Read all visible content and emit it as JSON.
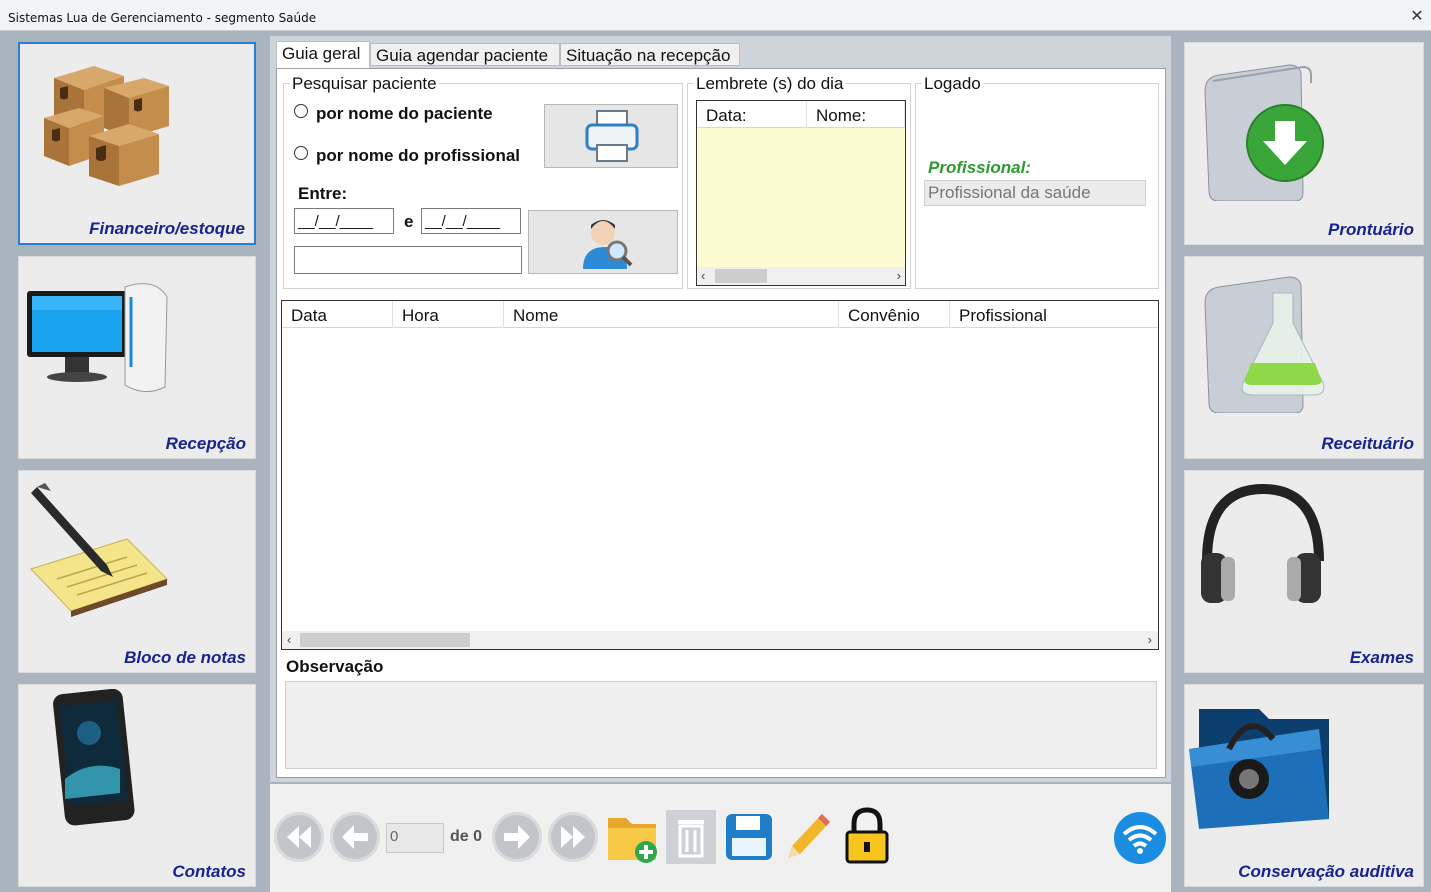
{
  "window": {
    "title": "Sistemas Lua de Gerenciamento - segmento Saúde",
    "close_glyph": "✕"
  },
  "left_menu": {
    "financeiro": "Financeiro/estoque",
    "recepcao": "Recepção",
    "bloco": "Bloco de notas",
    "contatos": "Contatos"
  },
  "right_menu": {
    "prontuario": "Prontuário",
    "receituario": "Receituário",
    "exames": "Exames",
    "conservacao": "Conservação auditiva"
  },
  "tabs": [
    "Guia geral",
    "Guia agendar paciente",
    "Situação na recepção"
  ],
  "search": {
    "title": "Pesquisar paciente",
    "opt_patient": "por nome do paciente",
    "opt_professional": "por nome do profissional",
    "between_label": "Entre:",
    "date_from": "__/__/____",
    "and_label": "e",
    "date_to": "__/__/____",
    "text_value": ""
  },
  "reminders": {
    "title": "Lembrete (s) do dia",
    "columns": [
      "Data:",
      "Nome:"
    ]
  },
  "logged": {
    "title": "Logado",
    "professional_label": "Profissional:",
    "professional_value": "Profissional da saúde"
  },
  "appointments": {
    "columns": [
      "Data",
      "Hora",
      "Nome",
      "Convênio",
      "Profissional"
    ],
    "rows": []
  },
  "observation": {
    "label": "Observação",
    "value": ""
  },
  "navigator": {
    "position": "0",
    "of_label": "de 0"
  },
  "colors": {
    "accent": "#16248f",
    "green_label": "#2e9a2e",
    "reminder_bg": "#fdfbd2"
  },
  "icons": [
    "ups-boxes-icon",
    "computer-icon",
    "notes-pen-icon",
    "smartphone-icon",
    "folder-download-icon",
    "folder-flask-icon",
    "headphones-icon",
    "folder-headphones-icon",
    "printer-icon",
    "user-search-icon",
    "first-icon",
    "prev-icon",
    "next-icon",
    "last-icon",
    "folder-add-icon",
    "trash-icon",
    "save-icon",
    "pencil-icon",
    "lock-icon",
    "wifi-icon"
  ]
}
